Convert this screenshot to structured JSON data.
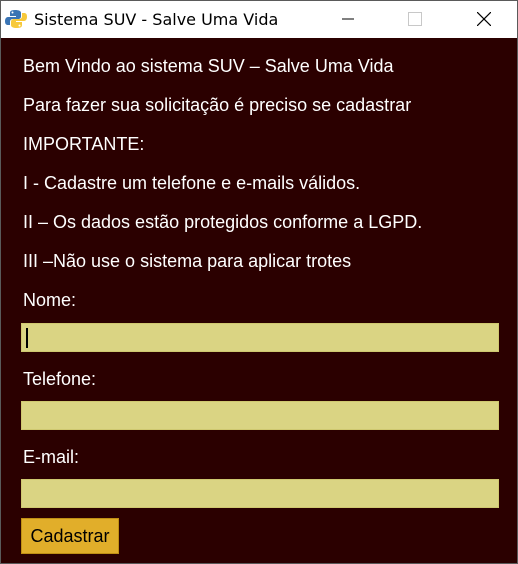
{
  "window": {
    "title": "Sistema SUV - Salve Uma Vida",
    "icon": "python-icon"
  },
  "colors": {
    "background": "#2b0000",
    "field": "#dad483",
    "button": "#e1ae2a",
    "text": "#ffffff"
  },
  "content": {
    "welcome": "Bem Vindo ao sistema SUV – Salve Uma Vida",
    "instruction": "Para fazer sua solicitação é preciso se cadastrar",
    "important": "IMPORTANTE:",
    "rule1": "I - Cadastre um telefone e e-mails válidos.",
    "rule2": "II – Os dados estão protegidos conforme a LGPD.",
    "rule3": "III –Não use o sistema para aplicar trotes"
  },
  "form": {
    "name_label": "Nome:",
    "name_value": "",
    "phone_label": "Telefone:",
    "phone_value": "",
    "email_label": "E-mail:",
    "email_value": "",
    "submit_label": "Cadastrar"
  }
}
